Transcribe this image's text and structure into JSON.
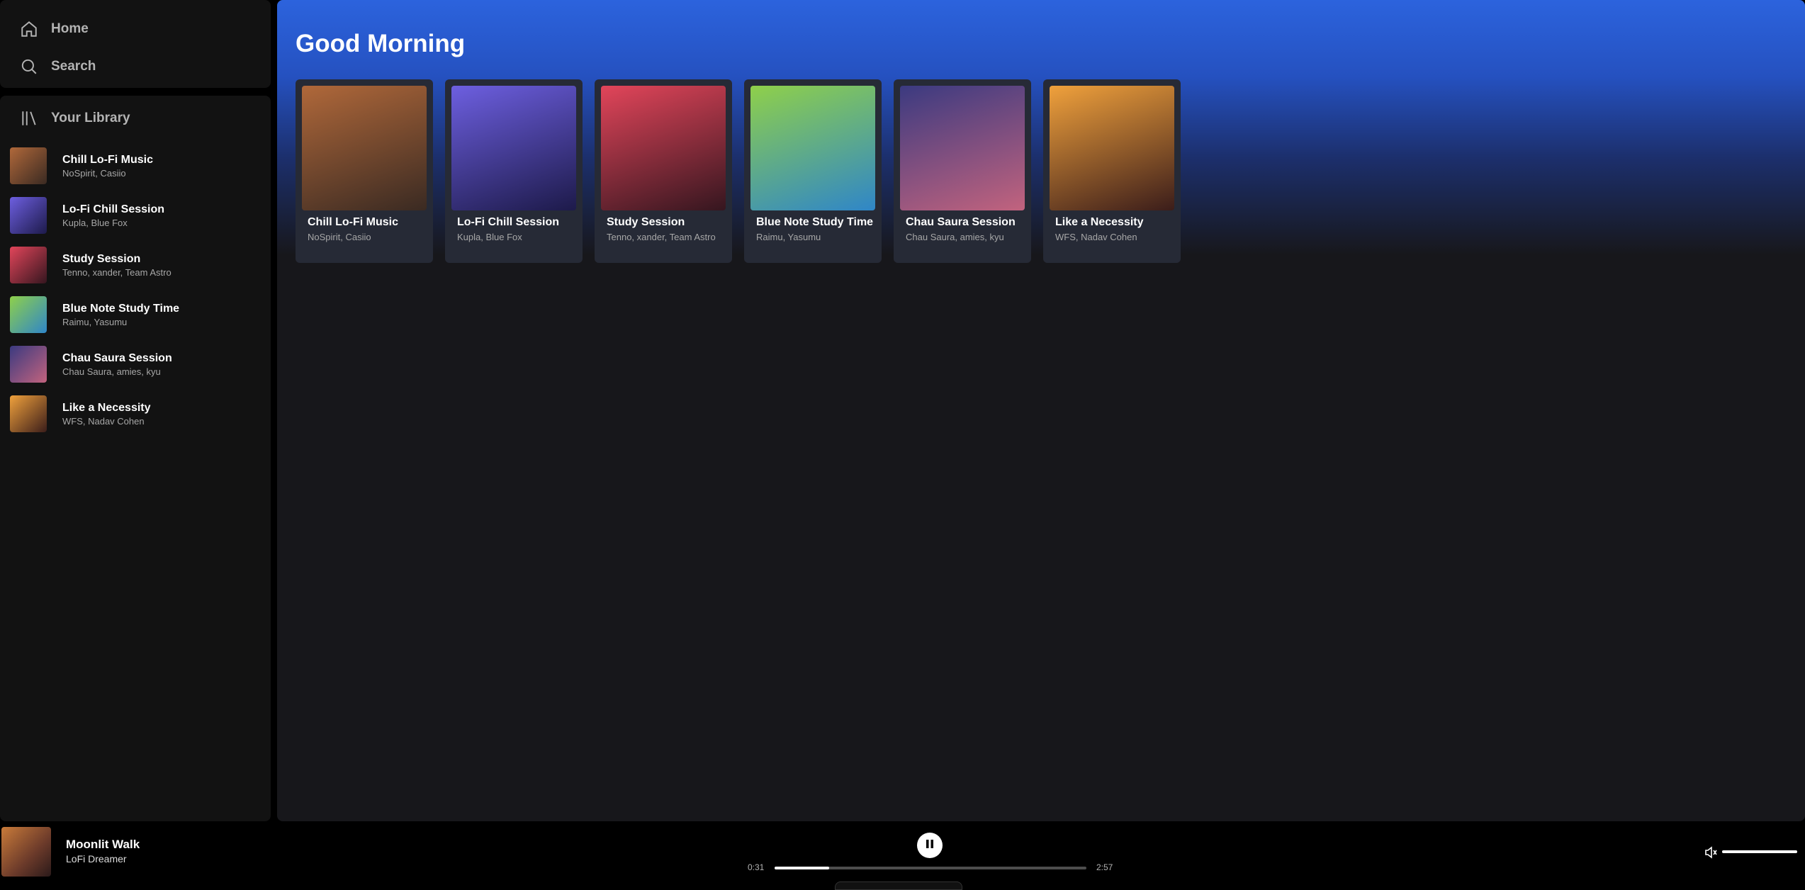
{
  "nav": {
    "home": "Home",
    "search": "Search",
    "library": "Your Library"
  },
  "library": [
    {
      "title": "Chill Lo-Fi Music",
      "artists": "NoSpirit, Casiio",
      "cover_colors": [
        "#b0683a",
        "#3a2a22"
      ]
    },
    {
      "title": "Lo-Fi Chill Session",
      "artists": "Kupla, Blue Fox",
      "cover_colors": [
        "#6d5fe0",
        "#1d1a4a"
      ]
    },
    {
      "title": "Study Session",
      "artists": "Tenno, xander, Team Astro",
      "cover_colors": [
        "#e2455a",
        "#35161f"
      ]
    },
    {
      "title": "Blue Note Study Time",
      "artists": "Raimu, Yasumu",
      "cover_colors": [
        "#8fd04a",
        "#2f86c8"
      ]
    },
    {
      "title": "Chau Saura Session",
      "artists": "Chau Saura, amies, kyu",
      "cover_colors": [
        "#3b3a80",
        "#c2637e"
      ]
    },
    {
      "title": "Like a Necessity",
      "artists": "WFS, Nadav Cohen",
      "cover_colors": [
        "#f0a13c",
        "#3b1d1a"
      ]
    }
  ],
  "main": {
    "greeting": "Good Morning",
    "gradient_color": "#2c63dd"
  },
  "player": {
    "title": "Moonlit Walk",
    "artist": "LoFi Dreamer",
    "elapsed": "0:31",
    "total": "2:57",
    "progress_fraction": 0.175,
    "volume_fraction": 1.0,
    "play_state_icon": "pause-icon",
    "volume_icon": "speaker-icon"
  }
}
